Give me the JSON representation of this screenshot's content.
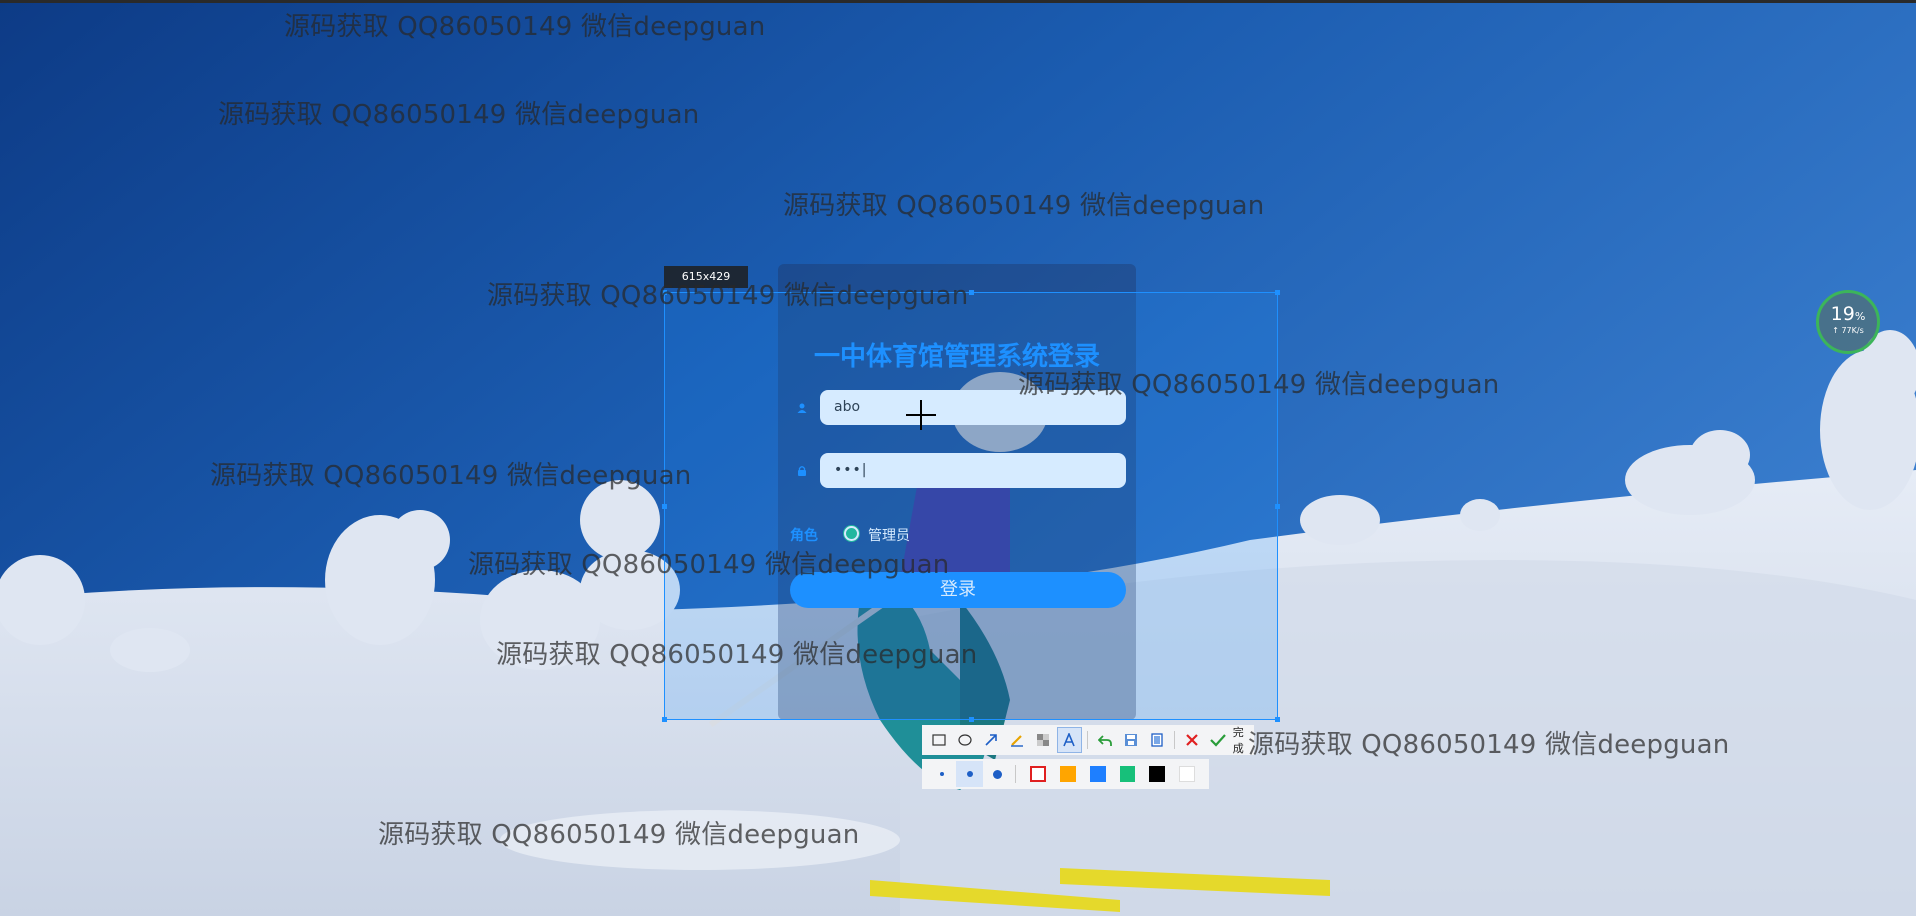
{
  "login": {
    "title": "一中体育馆管理系统登录",
    "username_value": "abo",
    "password_value": "•••|",
    "role_label": "角色",
    "role_option": "管理员",
    "login_button": "登录"
  },
  "capture": {
    "size_label": "615x429",
    "finish_label": "完成"
  },
  "toolbar": {
    "tools": [
      "rectangle-icon",
      "ellipse-icon",
      "arrow-icon",
      "pen-icon",
      "mosaic-icon",
      "text-icon",
      "undo-icon",
      "save-icon",
      "copy-icon",
      "cancel-icon",
      "confirm-icon"
    ],
    "active_tool": "text-icon",
    "stroke_sizes": [
      "small",
      "medium",
      "large"
    ],
    "active_stroke": "medium",
    "colors": [
      "#e02020",
      "#ffa500",
      "#1e7fff",
      "#17c07a",
      "#000000",
      "#ffffff"
    ],
    "selected_color": "#e02020"
  },
  "speed_widget": {
    "percent": "19",
    "percent_unit": "%",
    "rate": "↑ 77K/s"
  },
  "watermark": {
    "text": "源码获取 QQ86050149 微信deepguan",
    "text_partial": "源码获取 QQ86050149 微信deepguan"
  }
}
